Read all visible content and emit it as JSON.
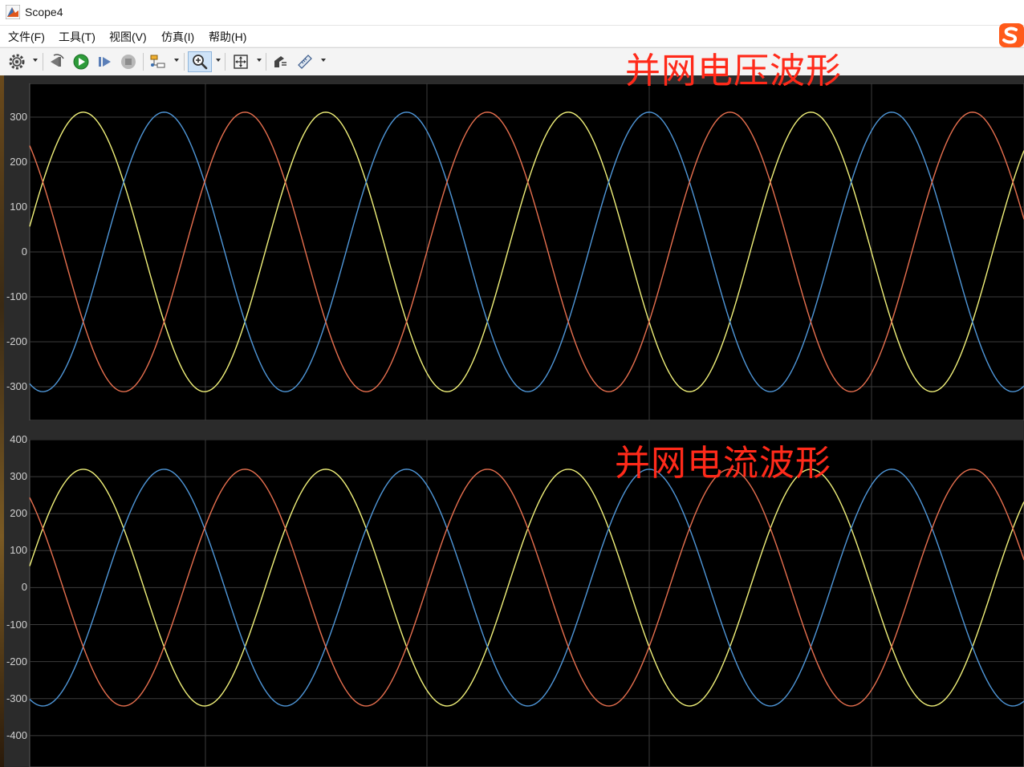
{
  "window": {
    "title": "Scope4"
  },
  "menu": [
    {
      "label": "文件(F)"
    },
    {
      "label": "工具(T)"
    },
    {
      "label": "视图(V)"
    },
    {
      "label": "仿真(I)"
    },
    {
      "label": "帮助(H)"
    }
  ],
  "toolbar": [
    {
      "icon": "gear-icon"
    },
    {
      "icon": "step-back-icon"
    },
    {
      "icon": "run-icon"
    },
    {
      "icon": "step-forward-icon"
    },
    {
      "icon": "stop-icon"
    },
    {
      "icon": "highlight-block-icon"
    },
    {
      "icon": "zoom-in-icon",
      "active": true
    },
    {
      "icon": "fit-axes-icon"
    },
    {
      "icon": "signal-selector-icon"
    },
    {
      "icon": "measurements-icon"
    }
  ],
  "colors": {
    "plot_background": "#000000",
    "grid": "#3c3c3c",
    "series_yellow": "#f2f27a",
    "series_blue": "#4f97d9",
    "series_orange": "#e8704f",
    "annotation": "#ff2a1a"
  },
  "annotations": {
    "voltage": "并网电压波形",
    "current": "并网电流波形"
  },
  "chart_data": [
    {
      "type": "line",
      "title": "",
      "xlabel": "",
      "ylabel": "",
      "ylim": [
        -375,
        375
      ],
      "yticks": [
        "300",
        "200",
        "100",
        "0",
        "-100",
        "-200",
        "-300"
      ],
      "ytick_values": [
        300,
        200,
        100,
        0,
        -100,
        -200,
        -300
      ],
      "grid": true,
      "periods_shown": 4.1,
      "series": [
        {
          "color": "series_yellow",
          "amplitude": 311,
          "start_value": 57,
          "phase_deg": 10.5
        },
        {
          "color": "series_blue",
          "amplitude": 311,
          "start_value": -294,
          "phase_deg": -109.5
        },
        {
          "color": "series_orange",
          "amplitude": 311,
          "start_value": 237,
          "phase_deg": 130.5
        }
      ]
    },
    {
      "type": "line",
      "title": "",
      "xlabel": "",
      "ylabel": "",
      "ylim": [
        -485,
        400
      ],
      "yticks": [
        "400",
        "300",
        "200",
        "100",
        "0",
        "-100",
        "-200",
        "-300",
        "-400"
      ],
      "ytick_values": [
        400,
        300,
        200,
        100,
        0,
        -100,
        -200,
        -300,
        -400
      ],
      "grid": true,
      "periods_shown": 4.1,
      "series": [
        {
          "color": "series_yellow",
          "amplitude": 320,
          "start_value": 58,
          "phase_deg": 10.5
        },
        {
          "color": "series_blue",
          "amplitude": 320,
          "start_value": -302,
          "phase_deg": -109.5
        },
        {
          "color": "series_orange",
          "amplitude": 320,
          "start_value": 244,
          "phase_deg": 130.5
        }
      ]
    }
  ]
}
